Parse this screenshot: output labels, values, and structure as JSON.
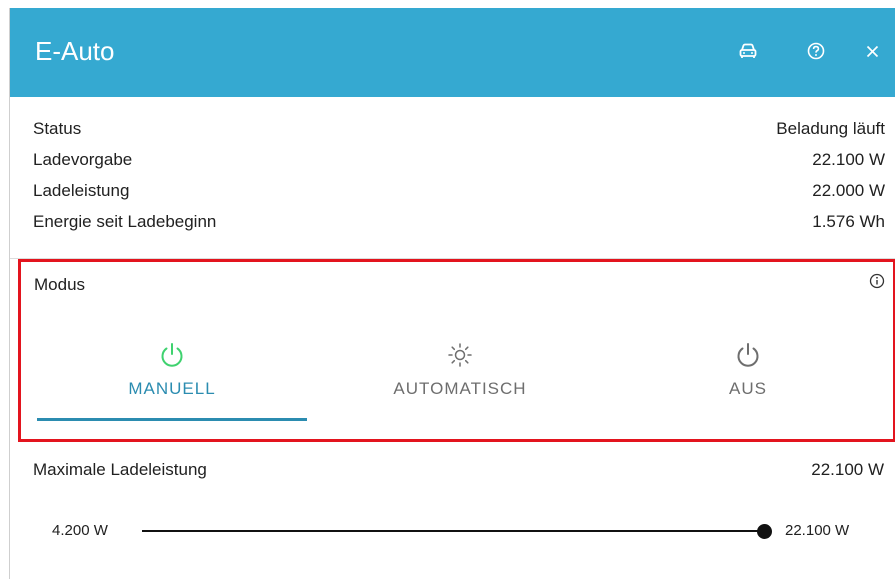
{
  "dialog": {
    "title": "E-Auto",
    "header_icons": [
      "car-icon",
      "help-icon",
      "close-icon"
    ],
    "colors": {
      "header_bg": "#35a9d1",
      "active": "#2b8cb0",
      "power_on": "#3fd26f",
      "highlight_border": "#e3141e"
    }
  },
  "info": [
    {
      "label": "Status",
      "value": "Beladung läuft"
    },
    {
      "label": "Ladevorgabe",
      "value": "22.100 W"
    },
    {
      "label": "Ladeleistung",
      "value": "22.000 W"
    },
    {
      "label": "Energie seit Ladebeginn",
      "value": "1.576 Wh"
    }
  ],
  "mode": {
    "label": "Modus",
    "info_icon": "info-icon",
    "selected": "MANUELL",
    "tabs": [
      {
        "label": "MANUELL",
        "icon": "power-icon"
      },
      {
        "label": "AUTOMATISCH",
        "icon": "sun-icon"
      },
      {
        "label": "AUS",
        "icon": "power-icon"
      }
    ]
  },
  "slider": {
    "title": "Maximale Ladeleistung",
    "value": "22.100 W",
    "min_label": "4.200 W",
    "max_label": "22.100 W",
    "level": 1.0
  }
}
